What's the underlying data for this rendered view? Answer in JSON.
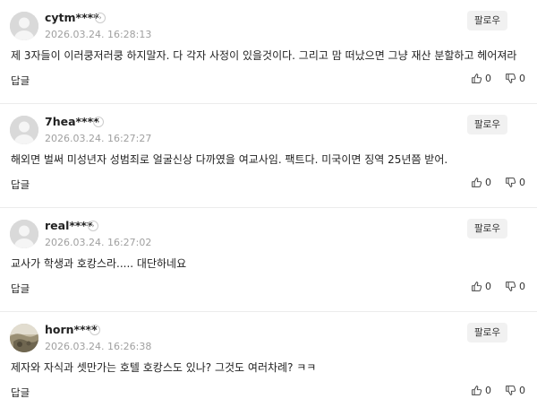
{
  "comments": [
    {
      "username": "cytm****",
      "timestamp": "2026.03.24. 16:28:13",
      "follow_label": "팔로우",
      "text": "제 3자들이 이러쿵저러쿵 하지말자. 다 각자 사정이 있을것이다. 그리고 맘 떠났으면 그냥 재산 분할하고 헤어져라",
      "reply_label": "답글",
      "likes": "0",
      "dislikes": "0",
      "avatar": "default-avatar-icon"
    },
    {
      "username": "7hea****",
      "timestamp": "2026.03.24. 16:27:27",
      "follow_label": "팔로우",
      "text": "해외면 벌써 미성년자 성범죄로 얼굴신상 다까였을 여교사임. 팩트다. 미국이면 징역 25년쯤 받어.",
      "reply_label": "답글",
      "likes": "0",
      "dislikes": "0",
      "avatar": "default-avatar-icon"
    },
    {
      "username": "real****",
      "timestamp": "2026.03.24. 16:27:02",
      "follow_label": "팔로우",
      "text": "교사가 학생과 호캉스라..... 대단하네요",
      "reply_label": "답글",
      "likes": "0",
      "dislikes": "0",
      "avatar": "default-avatar-icon"
    },
    {
      "username": "horn****",
      "timestamp": "2026.03.24. 16:26:38",
      "follow_label": "팔로우",
      "text": "제자와 자식과 셋만가는 호텔 호캉스도 있나? 그것도 여러차례? ㅋㅋ",
      "reply_label": "답글",
      "likes": "0",
      "dislikes": "0",
      "avatar": "photo-avatar"
    }
  ],
  "icons": {
    "profile_chevron": "chevron-right-icon",
    "like": "thumb-up-icon",
    "dislike": "thumb-down-icon"
  }
}
